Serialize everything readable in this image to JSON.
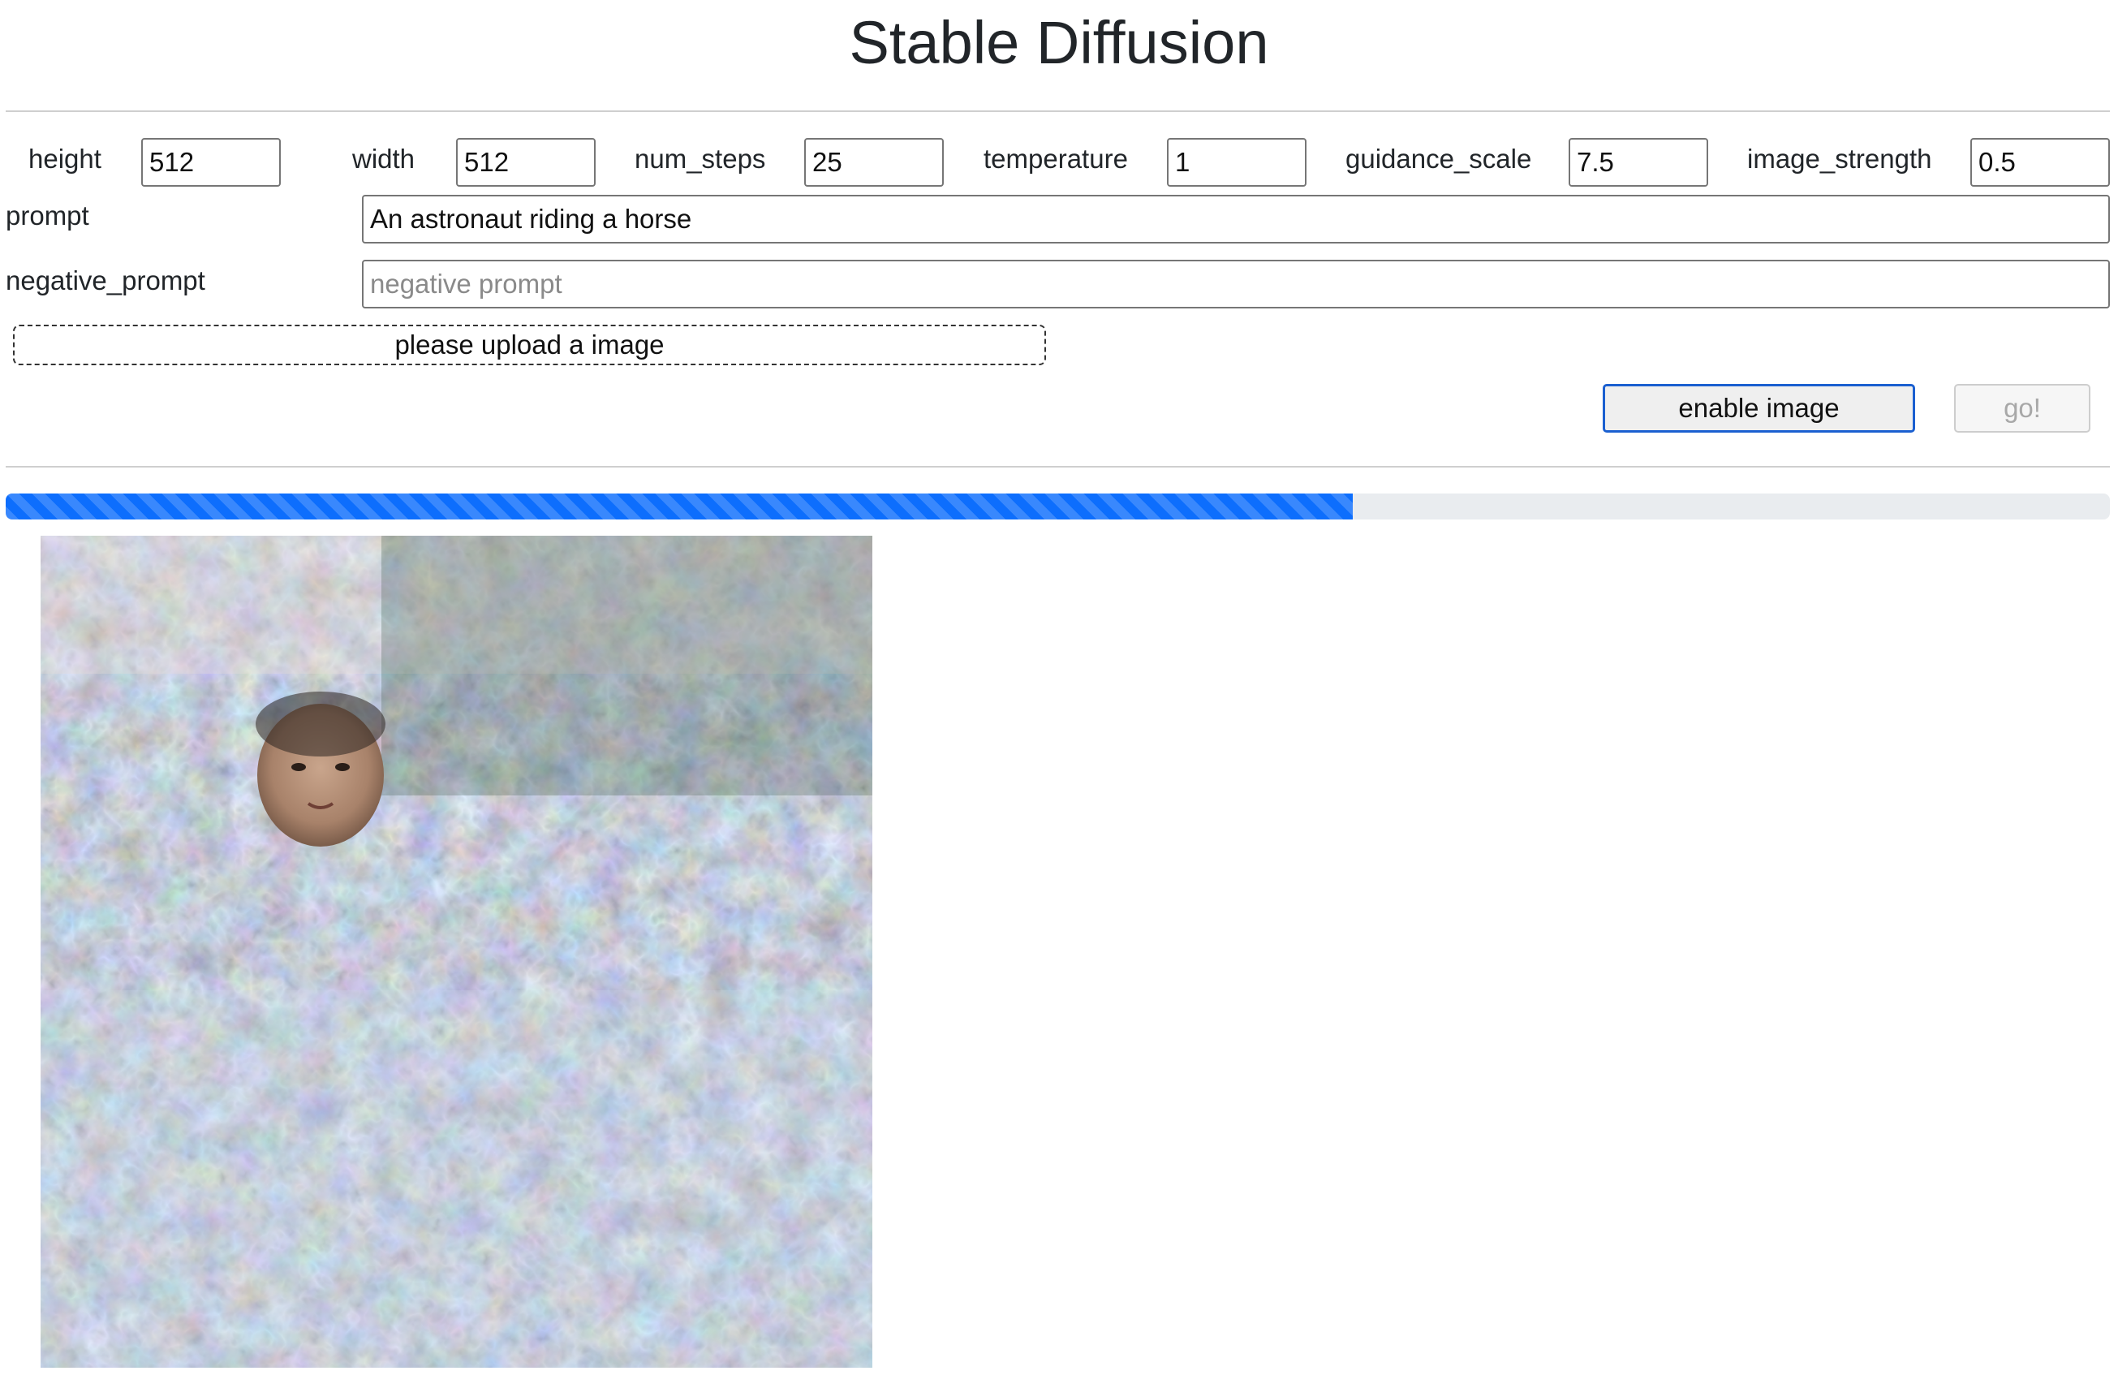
{
  "header": {
    "title": "Stable Diffusion"
  },
  "params": [
    {
      "key": "height",
      "label": "height",
      "value": "512"
    },
    {
      "key": "width",
      "label": "width",
      "value": "512"
    },
    {
      "key": "num_steps",
      "label": "num_steps",
      "value": "25"
    },
    {
      "key": "temperature",
      "label": "temperature",
      "value": "1"
    },
    {
      "key": "guidance_scale",
      "label": "guidance_scale",
      "value": "7.5"
    },
    {
      "key": "image_strength",
      "label": "image_strength",
      "value": "0.5"
    }
  ],
  "prompt": {
    "label": "prompt",
    "value": "An astronaut riding a horse"
  },
  "negative_prompt": {
    "label": "negative_prompt",
    "value": "",
    "placeholder": "negative prompt"
  },
  "upload": {
    "label": "please upload a image"
  },
  "actions": {
    "enable_image_label": "enable image",
    "go_label": "go!",
    "go_disabled": true
  },
  "progress": {
    "value": 0.64,
    "color": "#0d6efd",
    "track_color": "#e9ecef"
  },
  "output": {
    "description_icon": "generated-image"
  }
}
